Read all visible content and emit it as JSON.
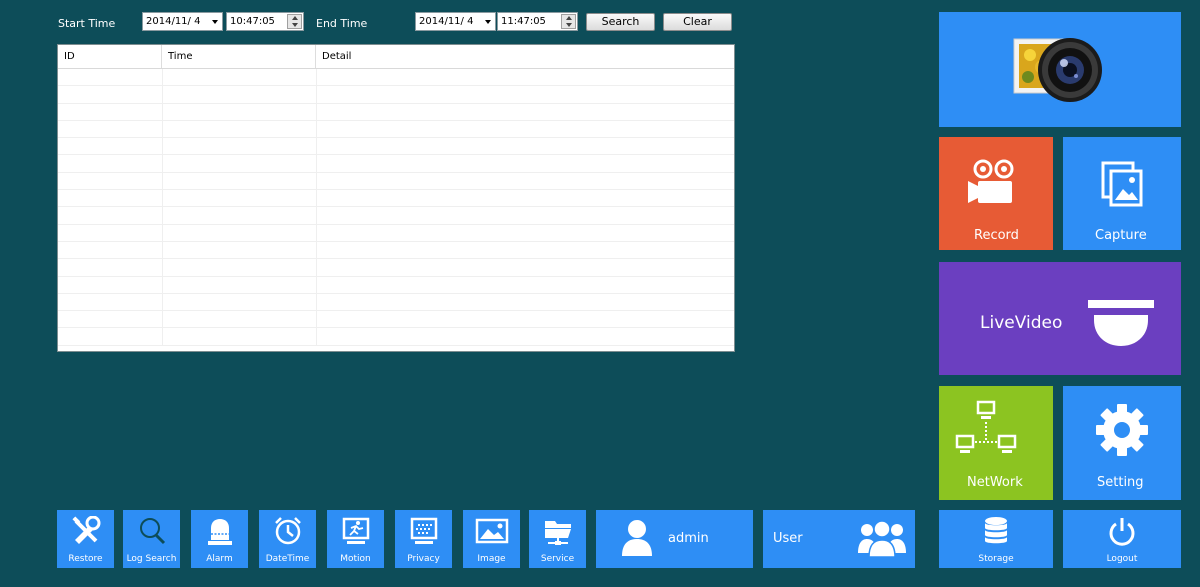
{
  "filter": {
    "start_label": "Start Time",
    "start_date": "2014/11/ 4",
    "start_time": "10:47:05",
    "end_label": "End Time",
    "end_date": "2014/11/ 4",
    "end_time": "11:47:05",
    "search_label": "Search",
    "clear_label": "Clear"
  },
  "log_table": {
    "columns": [
      "ID",
      "Time",
      "Detail"
    ],
    "rows": []
  },
  "tiles": {
    "record": "Record",
    "capture": "Capture",
    "livevideo": "LiveVideo",
    "network": "NetWork",
    "setting": "Setting",
    "storage": "Storage",
    "logout": "Logout"
  },
  "bottom_bar": {
    "restore": "Restore",
    "log_search": "Log Search",
    "alarm": "Alarm",
    "datetime": "DateTime",
    "motion": "Motion",
    "privacy": "Privacy",
    "image": "Image",
    "service": "Service",
    "user_name": "admin",
    "user_label": "User"
  },
  "colors": {
    "background": "#0d4d59",
    "tile_blue": "#2e8ef5",
    "tile_orange": "#e75b35",
    "tile_purple": "#6b3fc0",
    "tile_green": "#8cc421"
  }
}
